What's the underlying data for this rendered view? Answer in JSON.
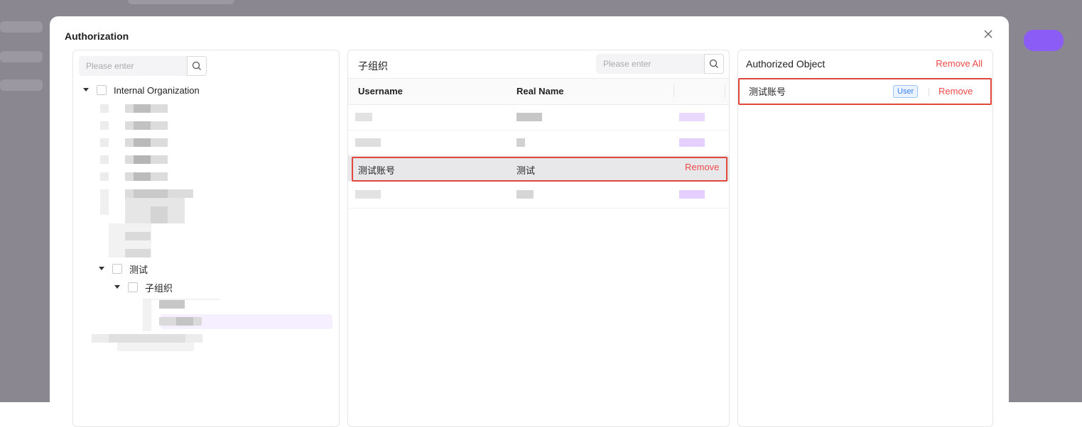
{
  "modal": {
    "title": "Authorization"
  },
  "left_panel": {
    "search_placeholder": "Please enter",
    "tree": {
      "root_label": "Internal Organization",
      "node_label": "测试",
      "child_label": "子组织"
    }
  },
  "middle_panel": {
    "title": "子组织",
    "search_placeholder": "Please enter",
    "columns": {
      "username": "Username",
      "real_name": "Real Name"
    },
    "selected_row": {
      "username": "测试账号",
      "real_name": "测试",
      "action": "Remove"
    }
  },
  "right_panel": {
    "title": "Authorized Object",
    "remove_all": "Remove All",
    "items": [
      {
        "name": "测试账号",
        "type": "User",
        "action": "Remove"
      }
    ]
  },
  "colors": {
    "accent_red": "#f04a4a",
    "outline_red": "#e0483c",
    "badge_blue": "#3b82f6",
    "highlight_purple": "#f5efff"
  }
}
